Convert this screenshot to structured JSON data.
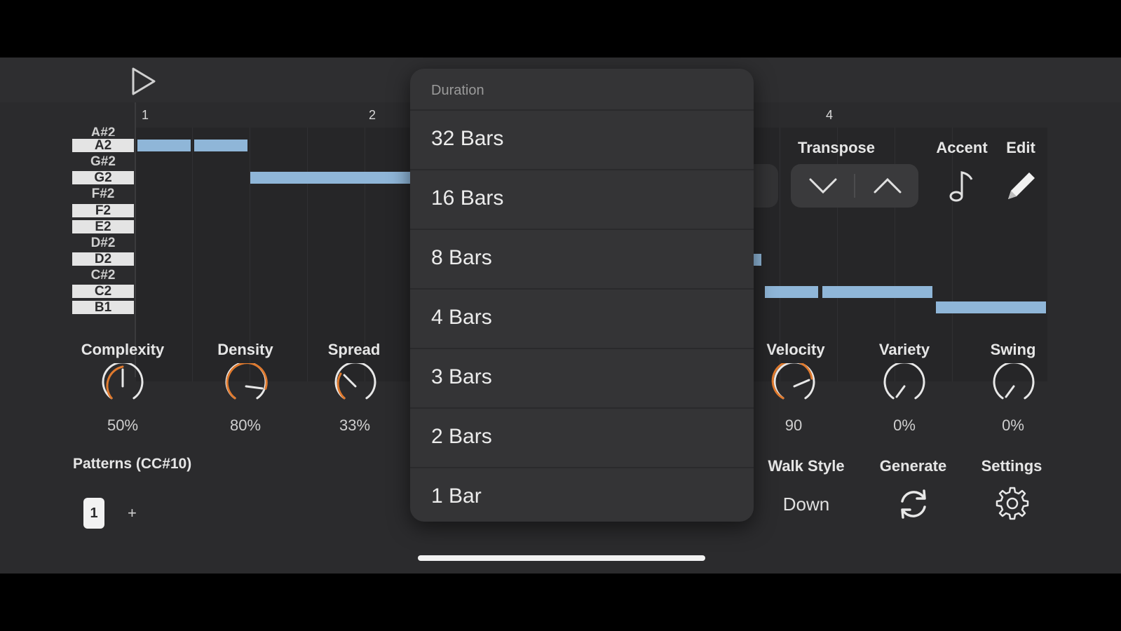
{
  "ruler": {
    "marks": [
      "1",
      "2",
      "4"
    ]
  },
  "piano_keys": [
    {
      "label": "A#2",
      "type": "black"
    },
    {
      "label": "A2",
      "type": "white"
    },
    {
      "label": "G#2",
      "type": "black"
    },
    {
      "label": "G2",
      "type": "white"
    },
    {
      "label": "F#2",
      "type": "black"
    },
    {
      "label": "F2",
      "type": "white"
    },
    {
      "label": "E2",
      "type": "white"
    },
    {
      "label": "D#2",
      "type": "black"
    },
    {
      "label": "D2",
      "type": "white"
    },
    {
      "label": "C#2",
      "type": "black"
    },
    {
      "label": "C2",
      "type": "white"
    },
    {
      "label": "B1",
      "type": "white"
    }
  ],
  "controls": {
    "transpose_label": "Transpose",
    "accent_label": "Accent",
    "edit_label": "Edit"
  },
  "knobs": [
    {
      "label": "Complexity",
      "value": "50%",
      "fraction": 0.5
    },
    {
      "label": "Density",
      "value": "80%",
      "fraction": 0.8
    },
    {
      "label": "Spread",
      "value": "33%",
      "fraction": 0.33
    },
    {
      "label": "Velocity",
      "value": "90",
      "fraction": 0.7
    },
    {
      "label": "Variety",
      "value": "0%",
      "fraction": 0.0
    },
    {
      "label": "Swing",
      "value": "0%",
      "fraction": 0.0
    }
  ],
  "patterns": {
    "label": "Patterns (CC#10)",
    "current": "1",
    "add": "+"
  },
  "walk_style": {
    "label": "Walk Style",
    "value": "Down"
  },
  "generate": {
    "label": "Generate"
  },
  "settings": {
    "label": "Settings"
  },
  "duration_menu": {
    "header": "Duration",
    "options": [
      "32 Bars",
      "16 Bars",
      "8 Bars",
      "4 Bars",
      "3 Bars",
      "2 Bars",
      "1 Bar"
    ]
  },
  "colors": {
    "accent": "#e07a2e",
    "note": "#8fb6d8",
    "background": "#2b2b2d"
  }
}
